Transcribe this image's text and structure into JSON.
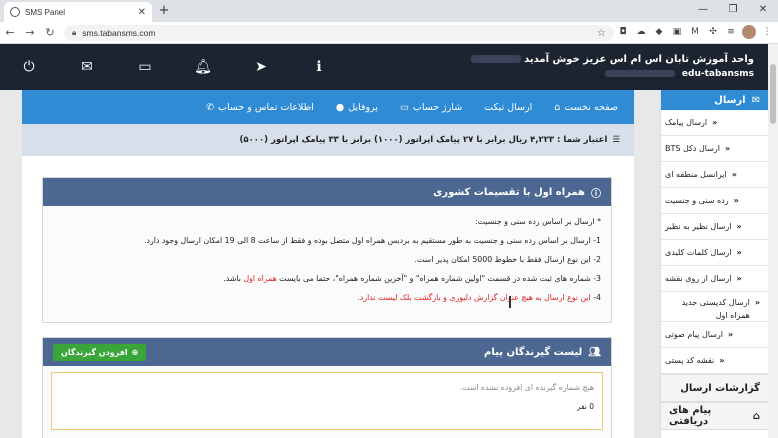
{
  "browser": {
    "tab_title": "SMS Panel",
    "tab_close": "✕",
    "new_tab": "+",
    "url": "sms.tabansms.com",
    "window_controls": [
      "—",
      "❐",
      "✕"
    ]
  },
  "header": {
    "welcome": "واحد آموزش تابان اس ام اس عزیز خوش آمدید",
    "username": "edu-tabansms",
    "icons": [
      "power-icon",
      "inbox-icon",
      "credit-card-icon",
      "bell-icon",
      "send-icon",
      "info-icon"
    ]
  },
  "nav": {
    "items": [
      {
        "label": "صفحه نخست",
        "icon": "home-icon",
        "glyph": "⌂"
      },
      {
        "label": "ارسال تیکت",
        "icon": "",
        "glyph": ""
      },
      {
        "label": "شارژ حساب",
        "icon": "credit-card-icon",
        "glyph": "▭"
      },
      {
        "label": "پروفایل",
        "icon": "user-icon",
        "glyph": "●"
      },
      {
        "label": "اطلاعات تماس و حساب",
        "icon": "phone-icon",
        "glyph": "✆"
      }
    ]
  },
  "credit": {
    "text": "اعتبار شما : ۴,۲۲۳ ریال برابر با ۲۷ پیامک اپراتور (۱۰۰۰) برابر با ۳۳ پیامک اپراتور (۵۰۰۰)"
  },
  "info_card": {
    "title": "همراه اول با تقسیمات کشوری",
    "lines": [
      "* ارسال بر اساس رده سنی و جنسیت:",
      "1- ارسال بر اساس رده سنی و جنسیت به طور مستقیم به بردیس همراه اول متصل بوده و فقط از ساعت 8 الی 19 امکان ارسال وجود دارد.",
      "2- این نوع ارسال فقط با خطوط 5000 امکان پذیر است."
    ],
    "line3_a": "3- شماره های ثبت شده در قسمت \"اولین شماره همراه\" و \"آخرین شماره همراه\"، حتما می بایست ",
    "line3_red": "همراه اول",
    "line3_b": " باشد.",
    "line4_prefix": "4- ",
    "line4_red": "این نوع ارسال به هیچ عنوان گزارش دلیوری و بازگشت بلک لیست ندارد."
  },
  "recipients": {
    "title": "لیست گیرندگان پیام",
    "add_button": "افزودن گیرندگان",
    "empty": "هیچ شماره گیرنده ای افزوده نشده است.",
    "count": "0 نفر"
  },
  "sidebar": {
    "header": "ارسال",
    "items": [
      "ارسال پیامک",
      "ارسال دکل BTS",
      "ایرانسل منطقه ای",
      "رده سنی و جنسیت",
      "ارسال نظیر به نظیر",
      "ارسال کلمات کلیدی",
      "ارسال از روی نقشه",
      "ارسال کدپستی جدید همراه اول",
      "ارسال پیام صوتی",
      "نقشه کد پستی"
    ],
    "reports": "گزارشات ارسال",
    "inbox": "پیام های دریافتی"
  },
  "colors": {
    "nav_blue": "#2f8bd3",
    "header_dark": "#1c2331",
    "card_head": "#4c6791",
    "add_green": "#3aa63a",
    "warning_red": "#e02020"
  }
}
